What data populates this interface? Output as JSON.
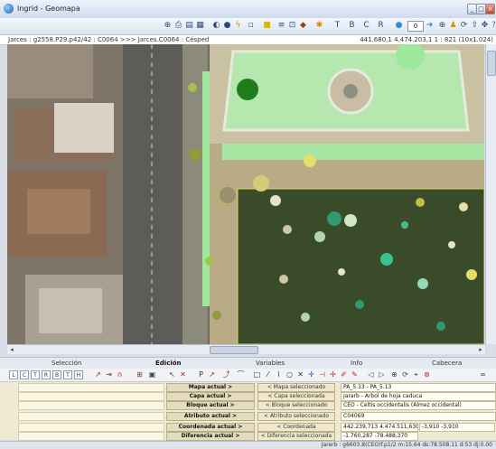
{
  "window": {
    "title": "Ingrid - Geomapa",
    "buttons": [
      "_",
      "□",
      "×"
    ]
  },
  "toolbar": {
    "icons": [
      "zoom-in-icon",
      "zoom-out-icon",
      "pan-icon",
      "refresh-icon",
      "full-extent-icon",
      "contrast-icon",
      "info-icon",
      "layers-icon",
      "polygon-icon",
      "grid-icon",
      "measure-icon",
      "link-icon",
      "text-tool-icon",
      "pointer-icon",
      "arrow-tool-icon",
      "query-icon",
      "scale-icon",
      "navigation-icon",
      "export-icon",
      "print-icon",
      "help-icon"
    ],
    "scale_value": "0"
  },
  "pathbar": {
    "path": "Jarces : g2558.P29.p42/42 : C0064 >>> Jarces.C0064 : Césped",
    "coords": "441.680,1  4.474.203,1   1 : 821 (10x1.024)"
  },
  "tabs": [
    "Selección",
    "Edición",
    "Variables",
    "Info",
    "Cabecera"
  ],
  "active_tab": "Edición",
  "edit_tools": {
    "left_codes": [
      "L",
      "C",
      "T",
      "R",
      "B",
      "T",
      "H"
    ],
    "vertex_label": "P",
    "icon_names": [
      "select-icon",
      "split-icon",
      "draw-line-icon",
      "close-icon",
      "pointer-tool-icon",
      "vertex-icon",
      "polyline-icon",
      "rectangle-tool-icon",
      "line-tool-icon",
      "curve-icon",
      "circle-tool-icon",
      "cross-icon",
      "freehand-icon",
      "shape-icon",
      "move-icon",
      "erase-icon",
      "undo-icon",
      "redo-icon",
      "snap-icon",
      "gps-icon",
      "binoculars-icon"
    ]
  },
  "info": {
    "rows": [
      {
        "label": "Mapa actual >",
        "button": "< Mapa seleccionado",
        "value": "PA_5.13 - PA_5.13"
      },
      {
        "label": "Capa actual >",
        "button": "< Capa seleccionada",
        "value": "Jararb - Árbol de hoja caduca"
      },
      {
        "label": "Bloque actual >",
        "button": "< Bloque seleccionado",
        "value": "CEO - Celtis occidentalis (Almez occidental)"
      },
      {
        "label": "Atributo actual >",
        "button": "< Atributo seleccionado",
        "value": "C04069"
      },
      {
        "label": "Coordenada actual >",
        "button": "< Coordenada seleccionada",
        "value": "442.239,713   4.474.511,630",
        "sub": "-3,910   -3,910"
      },
      {
        "label": "Diferencia actual >",
        "button": "< Diferencia seleccionada",
        "value": "-1.760,287   -78.488,370"
      }
    ]
  },
  "status": {
    "text": "Jarerb : g6603.8(CEO)f.p1/2  m:15.64  ds:78.508.11  d:53  dj:0.00"
  }
}
